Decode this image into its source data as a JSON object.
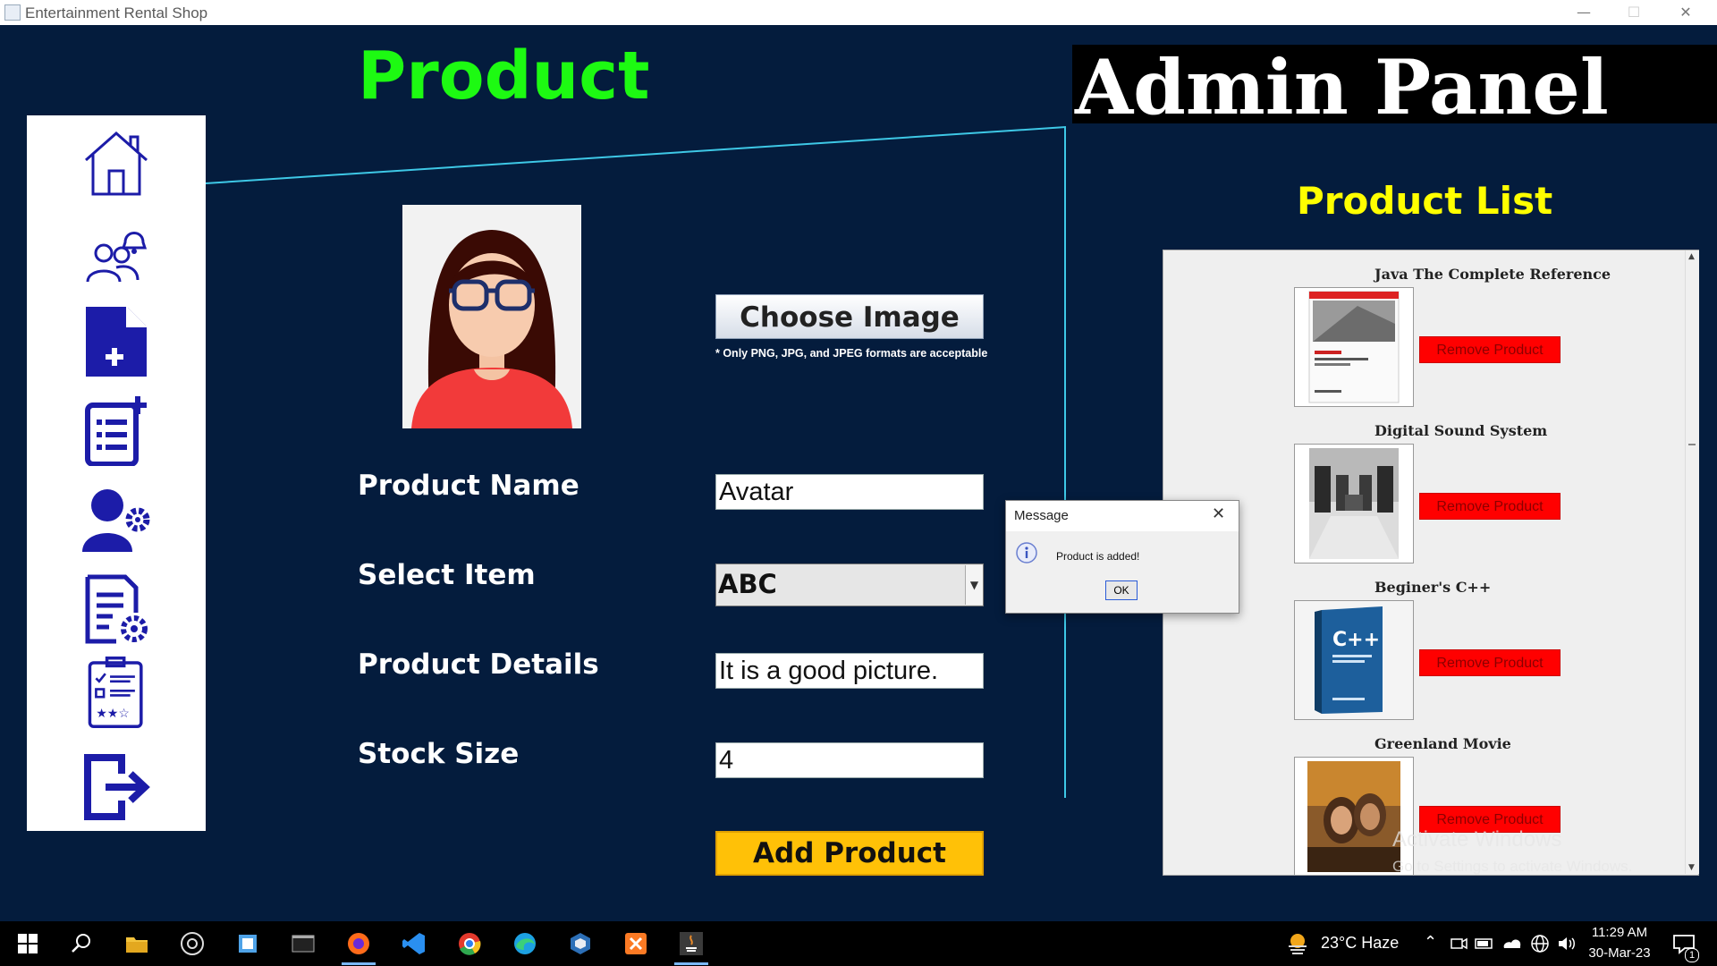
{
  "window": {
    "title": "Entertainment Rental Shop",
    "controls": [
      "—",
      "☐",
      "✕"
    ]
  },
  "page": {
    "heading": "Product",
    "admin_title": "Admin Panel"
  },
  "sidebar": {
    "items": [
      {
        "icon": "home-icon"
      },
      {
        "icon": "users-bell-icon"
      },
      {
        "icon": "add-file-icon"
      },
      {
        "icon": "add-list-icon"
      },
      {
        "icon": "user-settings-icon"
      },
      {
        "icon": "document-settings-icon"
      },
      {
        "icon": "checklist-rating-icon"
      },
      {
        "icon": "logout-icon"
      }
    ]
  },
  "form": {
    "choose_image_label": "Choose Image",
    "image_note": "* Only PNG, JPG, and JPEG formats are acceptable",
    "product_name_label": "Product Name",
    "product_name_value": "Avatar",
    "select_item_label": "Select Item",
    "select_item_value": "ABC",
    "product_details_label": "Product Details",
    "product_details_value": "It is a good picture.",
    "stock_size_label": "Stock Size",
    "stock_size_value": "4",
    "add_button_label": "Add Product"
  },
  "product_list": {
    "title": "Product List",
    "remove_label": "Remove Product",
    "items": [
      {
        "name": "Java The Complete Reference"
      },
      {
        "name": "Digital Sound System"
      },
      {
        "name": "Beginer's C++"
      },
      {
        "name": "Greenland Movie"
      }
    ]
  },
  "dialog": {
    "title": "Message",
    "message": "Product is added!",
    "ok_label": "OK"
  },
  "watermark": {
    "line1": "Activate Windows",
    "line2": "Go to Settings to activate Windows."
  },
  "taskbar": {
    "weather": "23°C  Haze",
    "time": "11:29 AM",
    "date": "30-Mar-23",
    "notification_count": "1"
  },
  "colors": {
    "background": "#041c3d",
    "heading": "#1dfa12",
    "list_title": "#ffff00",
    "add_button": "#ffc107",
    "remove_button": "#ff0000",
    "icon_blue": "#1c1ca8"
  }
}
